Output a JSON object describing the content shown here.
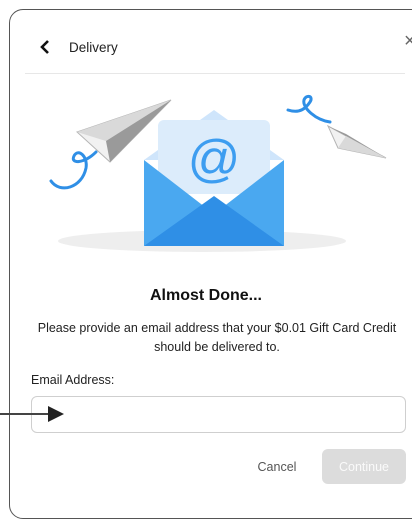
{
  "dialog": {
    "title": "Delivery",
    "close_glyph": "×",
    "back_icon": "chevron-left-icon"
  },
  "illustration": {
    "icon": "email-envelope-icon",
    "symbol": "@",
    "colors": {
      "envelope_dark": "#2f8fe6",
      "envelope_light": "#4aa8f0",
      "letter": "#dcecfb",
      "at_symbol": "#3d9df0",
      "string": "#2f8fe6",
      "plane": "#9a9a9a",
      "shadow": "#eeeeee"
    }
  },
  "content": {
    "heading": "Almost Done...",
    "description": "Please provide an email address that your $0.01 Gift Card Credit should be delivered to."
  },
  "form": {
    "email_label": "Email Address:",
    "email_value": "",
    "email_placeholder": ""
  },
  "buttons": {
    "cancel": "Cancel",
    "continue": "Continue"
  },
  "colors": {
    "border": "#555555",
    "continue_disabled_bg": "#dcdcdc",
    "pointer": "#222222"
  }
}
